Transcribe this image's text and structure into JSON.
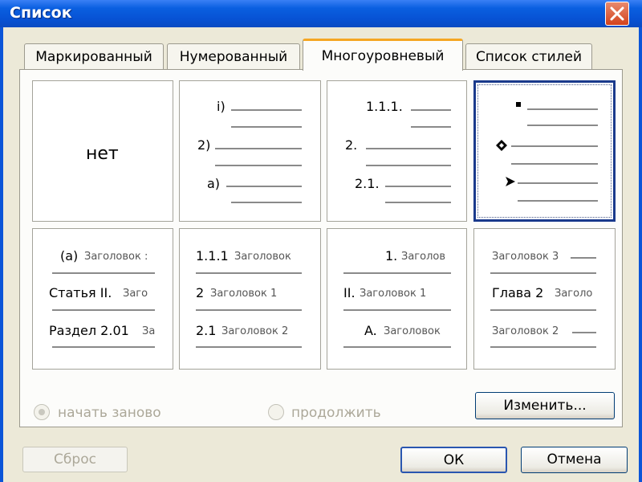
{
  "window": {
    "title": "Список"
  },
  "tabs": [
    {
      "label": "Маркированный"
    },
    {
      "label": "Нумерованный"
    },
    {
      "label": "Многоуровневый"
    },
    {
      "label": "Список стилей"
    }
  ],
  "gallery": {
    "none_label": "нет",
    "cell2": {
      "l1": "i)",
      "l2": "2)",
      "l3": "a)"
    },
    "cell3": {
      "l1": "1.1.1.",
      "l2": "2.",
      "l3": "2.1."
    },
    "cell4": {
      "icons": [
        "square-bullet-icon",
        "diamond-bullet-icon",
        "arrow-bullet-icon"
      ]
    },
    "cell5": {
      "l1_num": "(a)",
      "l1_txt": "Заголовок :",
      "l2_num": "Статья II.",
      "l2_txt": "Заго",
      "l3_num": "Раздел 2.01",
      "l3_txt": "За"
    },
    "cell6": {
      "l1_num": "1.1.1",
      "l1_txt": "Заголовок",
      "l2_num": "2",
      "l2_txt": "Заголовок 1",
      "l3_num": "2.1",
      "l3_txt": "Заголовок 2"
    },
    "cell7": {
      "l1_num": "1.",
      "l1_txt": "Заголов",
      "l2_num": "II.",
      "l2_txt": "Заголовок 1",
      "l3_num": "A.",
      "l3_txt": "Заголовок"
    },
    "cell8": {
      "l1_txt": "Заголовок 3",
      "l2_num": "Глава 2",
      "l2_txt": "Заголо",
      "l3_txt": "Заголовок 2"
    }
  },
  "options": {
    "restart_label": "начать заново",
    "continue_label": "продолжить"
  },
  "buttons": {
    "modify": "Изменить...",
    "reset": "Сброс",
    "ok": "ОК",
    "cancel": "Отмена"
  }
}
